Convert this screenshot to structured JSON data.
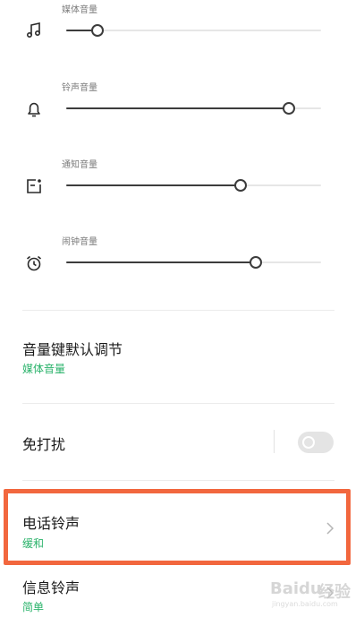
{
  "volume_sliders": [
    {
      "label": "媒体音量",
      "icon": "music-note-icon",
      "level": 0.12
    },
    {
      "label": "铃声音量",
      "icon": "bell-icon",
      "level": 0.87
    },
    {
      "label": "通知音量",
      "icon": "notification-icon",
      "level": 0.68
    },
    {
      "label": "闹钟音量",
      "icon": "alarm-clock-icon",
      "level": 0.74
    }
  ],
  "settings": {
    "volume_key": {
      "title": "音量键默认调节",
      "value": "媒体音量"
    },
    "do_not_disturb": {
      "title": "免打扰",
      "enabled": false
    },
    "ringtone": {
      "title": "电话铃声",
      "value": "缓和"
    },
    "message_tone": {
      "title": "信息铃声",
      "value": "简单"
    }
  },
  "watermark": {
    "brand": "Baidu",
    "suffix": "经验",
    "sub": "jingyan.baidu.com"
  },
  "colors": {
    "accent_green": "#2bb36b",
    "highlight": "#f2673e",
    "slider": "#3c3c3c",
    "track": "#e6e6e6"
  }
}
